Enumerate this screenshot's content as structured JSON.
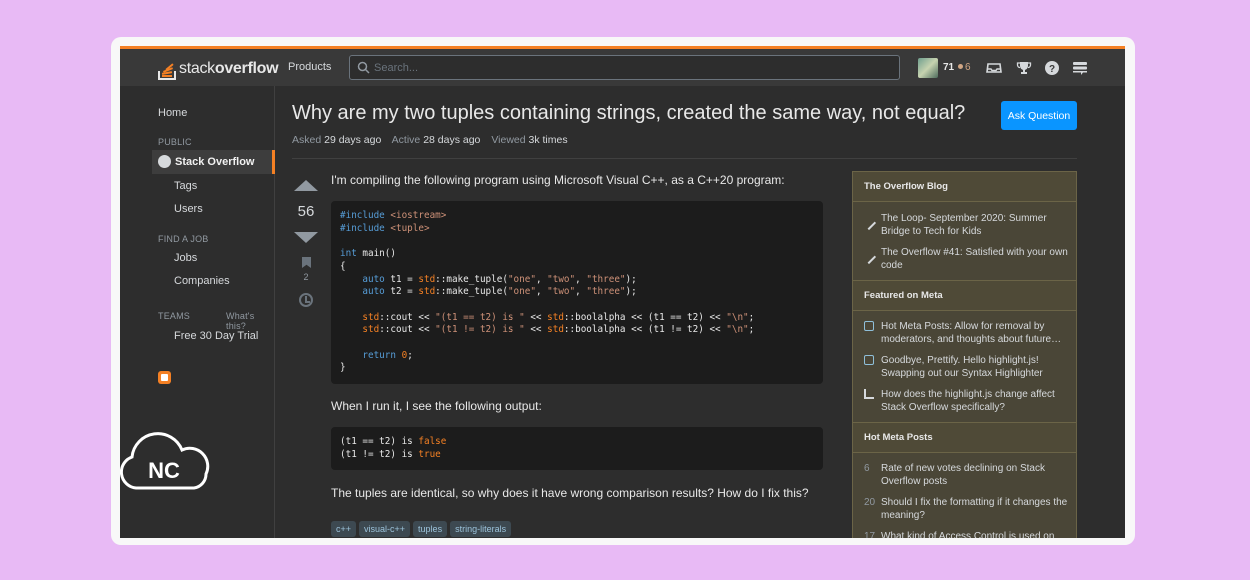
{
  "header": {
    "logo_light": "stack",
    "logo_bold": "overflow",
    "products": "Products",
    "search_placeholder": "Search...",
    "reputation": "71",
    "bronze_badges": "6"
  },
  "leftnav": {
    "home": "Home",
    "public_heading": "PUBLIC",
    "stack_overflow": "Stack Overflow",
    "tags": "Tags",
    "users": "Users",
    "find_job_heading": "FIND A JOB",
    "jobs": "Jobs",
    "companies": "Companies",
    "teams_heading": "TEAMS",
    "whats_this": "What's this?",
    "free_trial": "Free 30 Day Trial"
  },
  "question": {
    "title": "Why are my two tuples containing strings, created the same way, not equal?",
    "ask_button": "Ask Question",
    "asked_label": "Asked",
    "asked_value": "29 days ago",
    "active_label": "Active",
    "active_value": "28 days ago",
    "viewed_label": "Viewed",
    "viewed_value": "3k times",
    "votes": "56",
    "bookmarks": "2",
    "intro": "I'm compiling the following program using Microsoft Visual C++, as a C++20 program:",
    "output_intro": "When I run it, I see the following output:",
    "question_text": "The tuples are identical, so why does it have wrong comparison results? How do I fix this?",
    "tags": [
      "c++",
      "visual-c++",
      "tuples",
      "string-literals"
    ]
  },
  "code1": {
    "l1a": "#include",
    "l1b": "<iostream>",
    "l2a": "#include",
    "l2b": "<tuple>",
    "l4a": "int",
    "l4b": " main()",
    "l5": "{",
    "l6a": "    auto",
    "l6b": " t1 = ",
    "l6c": "std",
    "l6d": "::make_tuple(",
    "l6e": "\"one\"",
    "l6f": ", ",
    "l6g": "\"two\"",
    "l6h": ", ",
    "l6i": "\"three\"",
    "l6j": ");",
    "l7a": "    auto",
    "l7b": " t2 = ",
    "l7c": "std",
    "l7d": "::make_tuple(",
    "l7e": "\"one\"",
    "l7f": ", ",
    "l7g": "\"two\"",
    "l7h": ", ",
    "l7i": "\"three\"",
    "l7j": ");",
    "l9a": "    std",
    "l9b": "::cout << ",
    "l9c": "\"(t1 == t2) is \"",
    "l9d": " << ",
    "l9e": "std",
    "l9f": "::boolalpha << (t1 == t2) << ",
    "l9g": "\"\\n\"",
    "l9h": ";",
    "l10a": "    std",
    "l10b": "::cout << ",
    "l10c": "\"(t1 != t2) is \"",
    "l10d": " << ",
    "l10e": "std",
    "l10f": "::boolalpha << (t1 != t2) << ",
    "l10g": "\"\\n\"",
    "l10h": ";",
    "l12a": "    return",
    "l12b": " ",
    "l12c": "0",
    "l12d": ";",
    "l13": "}"
  },
  "code2": {
    "l1a": "(t1 == t2) is ",
    "l1b": "false",
    "l2a": "(t1 != t2) is ",
    "l2b": "true"
  },
  "sidebar": {
    "blog_heading": "The Overflow Blog",
    "blog_items": [
      "The Loop- September 2020: Summer Bridge to Tech for Kids",
      "The Overflow #41: Satisfied with your own code"
    ],
    "meta_heading": "Featured on Meta",
    "meta_items": [
      "Hot Meta Posts: Allow for removal by moderators, and thoughts about future…",
      "Goodbye, Prettify. Hello highlight.js! Swapping out our Syntax Highlighter",
      "How does the highlight.js change affect Stack Overflow specifically?"
    ],
    "hot_heading": "Hot Meta Posts",
    "hot_items": [
      {
        "count": "6",
        "text": "Rate of new votes declining on Stack Overflow posts"
      },
      {
        "count": "20",
        "text": "Should I fix the formatting if it changes the meaning?"
      },
      {
        "count": "17",
        "text": "What kind of Access Control is used on"
      }
    ]
  },
  "watermark": {
    "text": "NC"
  },
  "colors": {
    "accent": "#f48024",
    "primary_button": "#0a95ff",
    "background": "#e8baf5"
  }
}
